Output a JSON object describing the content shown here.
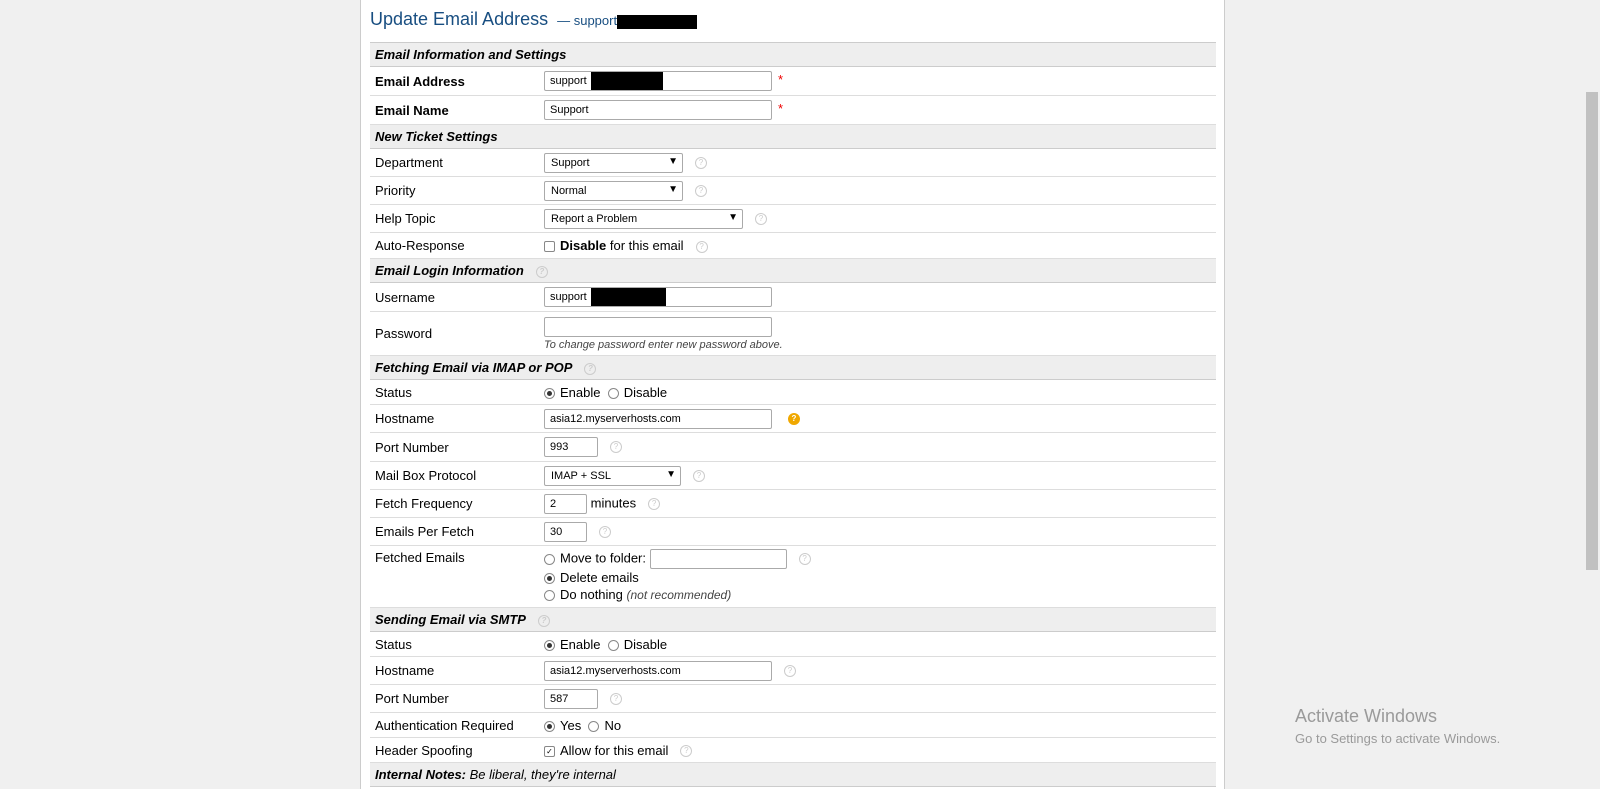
{
  "header": {
    "title": "Update Email Address",
    "subtitle": "— support"
  },
  "sections": {
    "email_info": "Email Information and Settings",
    "new_ticket": "New Ticket Settings",
    "login": "Email Login Information",
    "fetching": "Fetching Email via IMAP or POP",
    "sending": "Sending Email via SMTP",
    "notes": "Internal Notes:",
    "notes_sub": "Be liberal, they're internal"
  },
  "email_info": {
    "address_label": "Email Address",
    "address_value": "support",
    "name_label": "Email Name",
    "name_value": "Support",
    "required_mark": "*"
  },
  "new_ticket": {
    "department_label": "Department",
    "department_value": "Support",
    "priority_label": "Priority",
    "priority_value": "Normal",
    "help_topic_label": "Help Topic",
    "help_topic_value": "Report a Problem",
    "auto_response_label": "Auto-Response",
    "auto_response_bold": "Disable",
    "auto_response_text": "for this email"
  },
  "login": {
    "username_label": "Username",
    "username_value": "support",
    "password_label": "Password",
    "password_value": "",
    "password_note": "To change password enter new password above."
  },
  "fetching": {
    "status_label": "Status",
    "enable": "Enable",
    "disable": "Disable",
    "hostname_label": "Hostname",
    "hostname_value": "asia12.myserverhosts.com",
    "port_label": "Port Number",
    "port_value": "993",
    "protocol_label": "Mail Box Protocol",
    "protocol_value": "IMAP + SSL",
    "frequency_label": "Fetch Frequency",
    "frequency_value": "2",
    "frequency_unit": "minutes",
    "per_fetch_label": "Emails Per Fetch",
    "per_fetch_value": "30",
    "fetched_label": "Fetched Emails",
    "move_label": "Move to folder:",
    "move_value": "",
    "delete_label": "Delete emails",
    "nothing_label": "Do nothing",
    "nothing_note": "(not recommended)"
  },
  "sending": {
    "status_label": "Status",
    "enable": "Enable",
    "disable": "Disable",
    "hostname_label": "Hostname",
    "hostname_value": "asia12.myserverhosts.com",
    "port_label": "Port Number",
    "port_value": "587",
    "auth_label": "Authentication Required",
    "yes": "Yes",
    "no": "No",
    "spoof_label": "Header Spoofing",
    "spoof_text": "Allow for this email"
  },
  "watermark": {
    "line1": "Activate Windows",
    "line2": "Go to Settings to activate Windows."
  }
}
